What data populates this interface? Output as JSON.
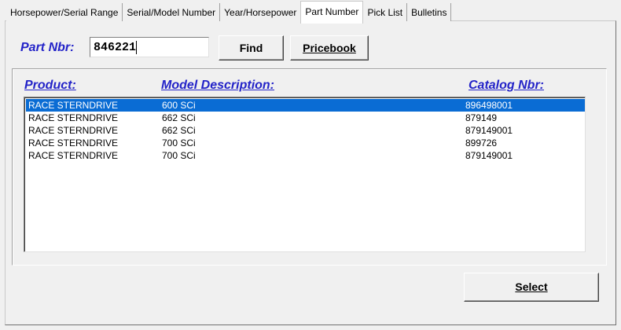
{
  "tabs": [
    "Horsepower/Serial Range",
    "Serial/Model Number",
    "Year/Horsepower",
    "Part Number",
    "Pick List",
    "Bulletins"
  ],
  "active_tab": "Part Number",
  "search": {
    "label": "Part Nbr:",
    "value": "846221"
  },
  "buttons": {
    "find": "Find",
    "pricebook": "Pricebook",
    "select": "Select"
  },
  "columns": {
    "product": "Product:",
    "model": "Model Description:",
    "catalog": "Catalog Nbr:"
  },
  "rows": [
    {
      "product": "RACE STERNDRIVE",
      "model": "600 SCi",
      "catalog": "896498001",
      "selected": true
    },
    {
      "product": "RACE STERNDRIVE",
      "model": "662 SCi",
      "catalog": "879149"
    },
    {
      "product": "RACE STERNDRIVE",
      "model": "662 SCi",
      "catalog": "879149001"
    },
    {
      "product": "RACE STERNDRIVE",
      "model": "700 SCi",
      "catalog": "899726"
    },
    {
      "product": "RACE STERNDRIVE",
      "model": "700 SCi",
      "catalog": "879149001"
    }
  ]
}
